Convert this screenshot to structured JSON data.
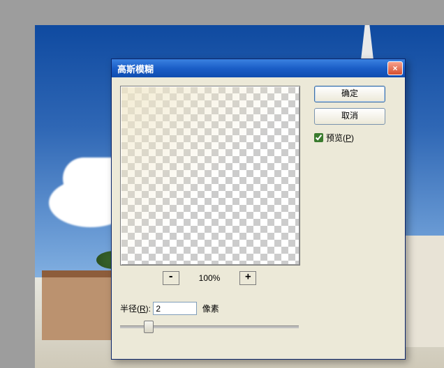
{
  "dialog": {
    "title": "高斯模糊",
    "close_icon": "×",
    "zoom": {
      "out_label": "-",
      "in_label": "+",
      "level": "100%"
    },
    "radius": {
      "label_prefix": "半径(",
      "label_hotkey": "R",
      "label_suffix": "):",
      "value": "2",
      "unit": "像素"
    },
    "buttons": {
      "ok": "确定",
      "cancel": "取消"
    },
    "preview_checkbox": {
      "checked": true,
      "label_prefix": "预览(",
      "label_hotkey": "P",
      "label_suffix": ")"
    }
  }
}
